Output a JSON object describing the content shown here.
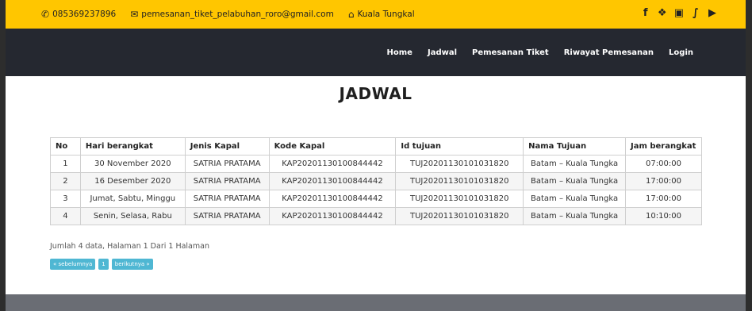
{
  "topbar": {
    "phone": "085369237896",
    "email": "pemesanan_tiket_pelabuhan_roro@gmail.com",
    "location": "Kuala Tungkal",
    "icons": [
      "phone-icon",
      "mail-icon",
      "home-icon"
    ],
    "social": [
      "facebook-icon",
      "twitter-icon",
      "instagram-icon",
      "google-plus-icon",
      "youtube-icon"
    ],
    "accent_color": "#ffc600"
  },
  "nav": {
    "items": [
      "Home",
      "Jadwal",
      "Pemesanan Tiket",
      "Riwayat Pemesanan",
      "Login"
    ],
    "background": "#252830"
  },
  "page": {
    "title": "JADWAL"
  },
  "table": {
    "headers": [
      "No",
      "Hari berangkat",
      "Jenis Kapal",
      "Kode Kapal",
      "Id tujuan",
      "Nama Tujuan",
      "Jam berangkat"
    ],
    "rows": [
      [
        "1",
        "30 November 2020",
        "SATRIA PRATAMA",
        "KAP20201130100844442",
        "TUJ20201130101031820",
        "Batam – Kuala Tungka",
        "07:00:00"
      ],
      [
        "2",
        "16 Desember 2020",
        "SATRIA PRATAMA",
        "KAP20201130100844442",
        "TUJ20201130101031820",
        "Batam – Kuala Tungka",
        "17:00:00"
      ],
      [
        "3",
        "Jumat, Sabtu, Minggu",
        "SATRIA PRATAMA",
        "KAP20201130100844442",
        "TUJ20201130101031820",
        "Batam – Kuala Tungka",
        "17:00:00"
      ],
      [
        "4",
        "Senin, Selasa, Rabu",
        "SATRIA PRATAMA",
        "KAP20201130100844442",
        "TUJ20201130101031820",
        "Batam – Kuala Tungka",
        "10:10:00"
      ]
    ]
  },
  "pagination": {
    "summary": "Jumlah 4 data, Halaman 1 Dari 1 Halaman",
    "prev": "« sebelumnya",
    "page": "1",
    "next": "berikutnya »",
    "button_color": "#4fb7d3"
  }
}
